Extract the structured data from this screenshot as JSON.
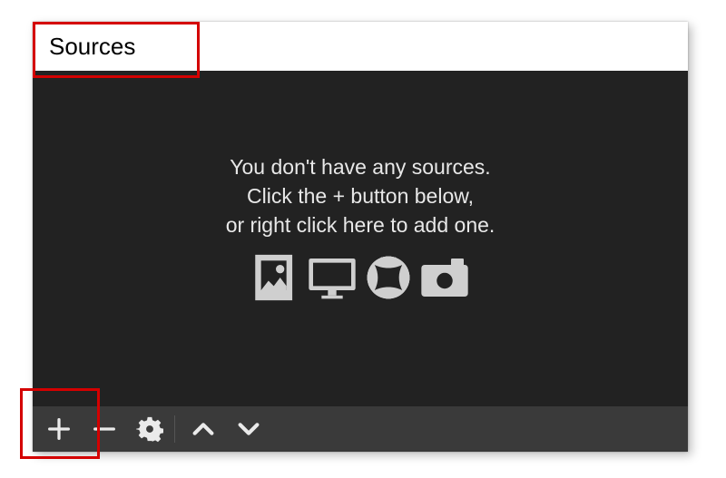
{
  "header": {
    "title": "Sources"
  },
  "placeholder": {
    "line1": "You don't have any sources.",
    "line2": "Click the + button below,",
    "line3": "or right click here to add one."
  },
  "toolbar": {
    "add_label": "Add source",
    "remove_label": "Remove source",
    "settings_label": "Source properties",
    "move_up_label": "Move source up",
    "move_down_label": "Move source down"
  },
  "icons": {
    "image": "image-icon",
    "display": "display-icon",
    "globe": "globe-icon",
    "camera": "camera-icon"
  },
  "colors": {
    "content_bg": "#222222",
    "toolbar_bg": "#3a3a3a",
    "text": "#e8e8e8",
    "highlight": "#d40000"
  }
}
